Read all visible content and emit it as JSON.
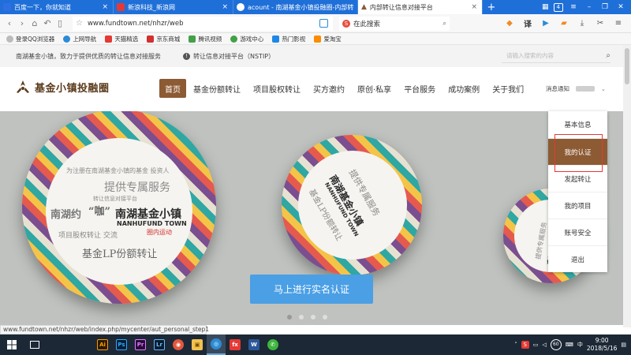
{
  "browser": {
    "tabs": [
      {
        "title": "百度一下，你就知道",
        "color": "#2f6fe4",
        "active": false
      },
      {
        "title": "新浪科技_新浪网",
        "color": "#e53935",
        "active": false
      },
      {
        "title": "acount - 南湖基金小镇投融圈-内部转",
        "color": "#ffffff",
        "active": false
      },
      {
        "title": "内部转让信息对接平台",
        "color": "#8c5a33",
        "active": true
      }
    ],
    "tab_count": "4",
    "url": "www.fundtown.net/nhzr/web",
    "search_placeholder": "在此搜索",
    "status_url": "www.fundtown.net/nhzr/web/index.php/mycenter/aut_personal_step1"
  },
  "bookmarks": [
    {
      "label": "登录QQ浏览器",
      "color": "#999999"
    },
    {
      "label": "上网导航",
      "color": "#2a8cd6"
    },
    {
      "label": "天猫精选",
      "color": "#e53935"
    },
    {
      "label": "京东商城",
      "color": "#d32f2f"
    },
    {
      "label": "腾讯视频",
      "color": "#43a047"
    },
    {
      "label": "游戏中心",
      "color": "#43a047"
    },
    {
      "label": "热门影视",
      "color": "#1e88e5"
    },
    {
      "label": "爱淘宝",
      "color": "#fb8c00"
    }
  ],
  "site": {
    "slogan": "南湖基金小镇，致力于提供优质的转让信息对接服务",
    "platform": "转让信息对接平台（NSTIP）",
    "search_placeholder": "请输入搜索的内容",
    "logo_text": "基金小镇投融圈",
    "nav": [
      "首页",
      "基金份额转让",
      "项目股权转让",
      "买方邀约",
      "原创·私享",
      "平台服务",
      "成功案例",
      "关于我们"
    ],
    "active_nav": 0,
    "messages": "消息通知",
    "user_menu": [
      "基本信息",
      "我的认证",
      "发起转让",
      "我的项目",
      "账号安全",
      "退出"
    ],
    "selected_menu": 1,
    "accent_color": "#8c5a33"
  },
  "hero": {
    "lines": [
      "为注册在南湖基金小镇的基金 投资人",
      "提供专属服务",
      "转让信息对接平台",
      "南湖约",
      "“咖”",
      "南湖基金小镇",
      "NANHUFUND TOWN",
      "圈内运动",
      "项目股权转让 交流",
      "基金LP份额转让"
    ],
    "cta": "马上进行实名认证",
    "slides": 4,
    "current_slide": 1
  },
  "taskbar": {
    "apps": [
      {
        "label": "Ai",
        "color": "#2b1a05",
        "text": "#ff9a00"
      },
      {
        "label": "Ps",
        "color": "#001e36",
        "text": "#31a8ff"
      },
      {
        "label": "Pr",
        "color": "#2a0a3a",
        "text": "#e07cff"
      },
      {
        "label": "Lr",
        "color": "#0a1d2e",
        "text": "#6ab7ff"
      },
      {
        "label": "◉",
        "color": "#e1573d",
        "text": "#ffffff"
      },
      {
        "label": "▣",
        "color": "#f2c14e",
        "text": "#6b4a00"
      },
      {
        "label": "◎",
        "color": "#2a8cd6",
        "text": "#ffffff"
      },
      {
        "label": "fx",
        "color": "#e53935",
        "text": "#ffffff"
      },
      {
        "label": "W",
        "color": "#2b579a",
        "text": "#ffffff"
      },
      {
        "label": "✆",
        "color": "#3db53d",
        "text": "#ffffff"
      }
    ],
    "active_app": 6,
    "time": "9:00",
    "date": "2018/5/16",
    "notification_count": "60"
  }
}
